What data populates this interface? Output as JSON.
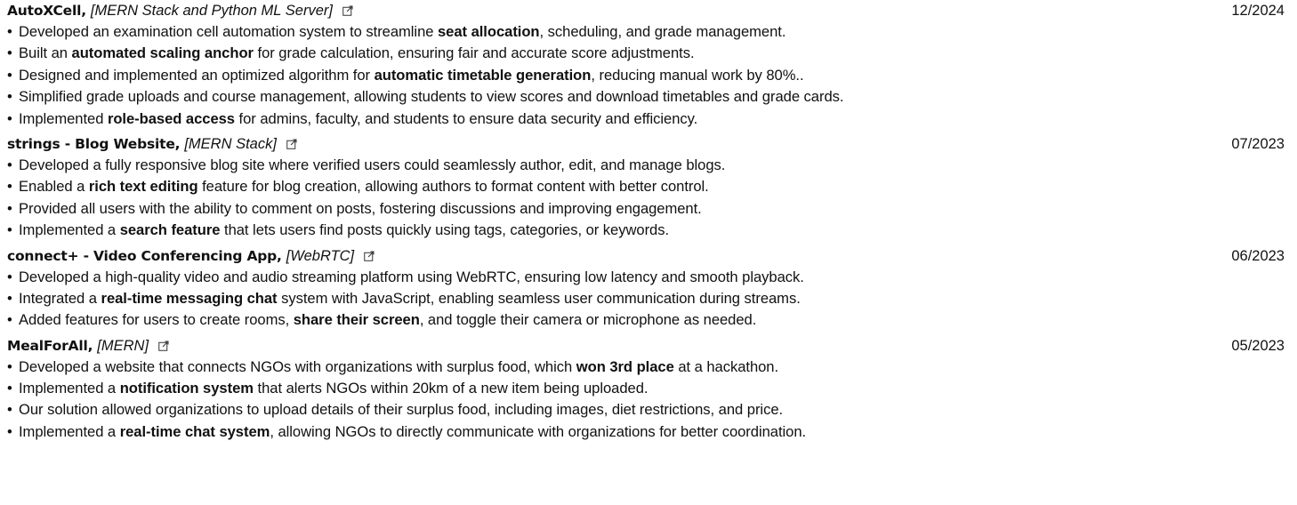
{
  "projects": [
    {
      "title": "AutoXCell,",
      "stack": "[MERN Stack and Python ML Server]",
      "date": "12/2024",
      "link_icon": "external-link-icon",
      "bullets": [
        [
          {
            "t": "Developed an examination cell automation system to streamline "
          },
          {
            "t": "seat allocation",
            "b": true
          },
          {
            "t": ", scheduling, and grade management."
          }
        ],
        [
          {
            "t": "Built an "
          },
          {
            "t": "automated scaling anchor",
            "b": true
          },
          {
            "t": " for grade calculation, ensuring fair and accurate score adjustments."
          }
        ],
        [
          {
            "t": "Designed and implemented an optimized algorithm for "
          },
          {
            "t": "automatic timetable generation",
            "b": true
          },
          {
            "t": ", reducing manual work by 80%.."
          }
        ],
        [
          {
            "t": "Simplified grade uploads and course management, allowing students to view scores and download timetables and grade cards."
          }
        ],
        [
          {
            "t": "Implemented "
          },
          {
            "t": "role-based access",
            "b": true
          },
          {
            "t": " for admins, faculty, and students to ensure data security and efficiency."
          }
        ]
      ]
    },
    {
      "title": "strings - Blog Website,",
      "stack": "[MERN Stack]",
      "date": "07/2023",
      "link_icon": "external-link-icon",
      "bullets": [
        [
          {
            "t": "Developed a fully responsive blog site where verified users could seamlessly author, edit, and manage blogs."
          }
        ],
        [
          {
            "t": "Enabled a "
          },
          {
            "t": "rich text editing",
            "b": true
          },
          {
            "t": " feature for blog creation, allowing authors to format content with better control."
          }
        ],
        [
          {
            "t": "Provided all users with the ability to comment on posts, fostering discussions and improving engagement."
          }
        ],
        [
          {
            "t": "Implemented a "
          },
          {
            "t": "search feature",
            "b": true
          },
          {
            "t": " that lets users find posts quickly using tags, categories, or keywords."
          }
        ]
      ]
    },
    {
      "title": "connect+ - Video Conferencing App,",
      "stack": "[WebRTC]",
      "date": "06/2023",
      "link_icon": "external-link-icon",
      "bullets": [
        [
          {
            "t": "Developed a high-quality video and audio streaming platform using WebRTC, ensuring low latency and smooth playback."
          }
        ],
        [
          {
            "t": "Integrated a "
          },
          {
            "t": "real-time messaging chat",
            "b": true
          },
          {
            "t": " system with JavaScript, enabling seamless user communication during streams."
          }
        ],
        [
          {
            "t": "Added features for users to create rooms, "
          },
          {
            "t": "share their screen",
            "b": true
          },
          {
            "t": ", and toggle their camera or microphone as needed."
          }
        ]
      ]
    },
    {
      "title": "MealForAll,",
      "stack": "[MERN]",
      "date": "05/2023",
      "link_icon": "external-link-icon",
      "bullets": [
        [
          {
            "t": "Developed a website that connects NGOs with organizations with surplus food, which "
          },
          {
            "t": "won 3rd place",
            "b": true
          },
          {
            "t": " at a hackathon."
          }
        ],
        [
          {
            "t": "Implemented a "
          },
          {
            "t": "notification system",
            "b": true
          },
          {
            "t": " that alerts NGOs within 20km of a new item being uploaded."
          }
        ],
        [
          {
            "t": "Our solution allowed organizations to upload details of their surplus food, including images, diet restrictions, and price."
          }
        ],
        [
          {
            "t": "Implemented a "
          },
          {
            "t": "real-time chat system",
            "b": true
          },
          {
            "t": ", allowing NGOs to directly communicate with organizations for better coordination."
          }
        ]
      ]
    }
  ],
  "bullet_glyph": "•"
}
